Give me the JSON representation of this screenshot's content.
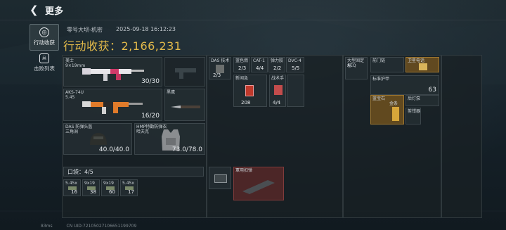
{
  "header": {
    "back_icon": "chevron-left-icon",
    "title": "更多"
  },
  "sidebar": {
    "tabs": [
      {
        "label": "行动收获",
        "icon": "target-icon",
        "active": true
      },
      {
        "label": "击败列表",
        "icon": "skull-icon",
        "active": false
      }
    ]
  },
  "raid": {
    "map": "零号大坝-机密",
    "datetime": "2025-09-18 16:12:23",
    "profit_label": "行动收获：2,166,231"
  },
  "loadout": {
    "gun1": {
      "name": "美士",
      "sub": "9×19mm",
      "ammo": "30/30"
    },
    "gun2": {
      "name": "AKS-74U",
      "sub": "5.45",
      "ammo": "16/20"
    },
    "melee": {
      "name": "黑鹰"
    },
    "helmet": {
      "name": "DAS 防弹头盔",
      "sub": "三角洲",
      "durability": "40.0/40.0"
    },
    "armor": {
      "name": "HMP特勤防弹衣",
      "sub": "哈夫克",
      "durability": "73.0/78.0"
    }
  },
  "pocket": {
    "label": "口袋：4/5",
    "ammo": [
      {
        "name": "5.45x",
        "count": "16"
      },
      {
        "name": "9x19",
        "count": "38"
      },
      {
        "name": "9x19",
        "count": "60"
      },
      {
        "name": "5.45x",
        "count": "17"
      }
    ]
  },
  "rig": {
    "cells": [
      {
        "label": "DAS 技术",
        "count": "2/3"
      },
      {
        "label": "蓝色燃",
        "count": "2/3"
      },
      {
        "label": "CAT-1",
        "count": "4/4"
      },
      {
        "label": "弹力胶",
        "count": "2/2"
      },
      {
        "label": "DVC-4",
        "count": "5/5"
      }
    ],
    "red": {
      "label": "新闻急",
      "count": "208"
    },
    "red2": {
      "label": "战术手",
      "count": "4/4"
    }
  },
  "backpack": {
    "cells": [
      {
        "label": "大型固定包",
        "sub": "AEQ"
      },
      {
        "label": "前门链"
      },
      {
        "label": "卫星电话"
      },
      {
        "label": "标准护甲",
        "count": "63"
      },
      {
        "label": "蓝宝石",
        "sub": "金条"
      },
      {
        "label": "后灯泵"
      },
      {
        "label": "剪钳器"
      }
    ]
  },
  "secure": {
    "label": "軍用扣弹"
  },
  "footer": {
    "ping": "83ms",
    "uid": "CN UID:72105027106651199709"
  }
}
